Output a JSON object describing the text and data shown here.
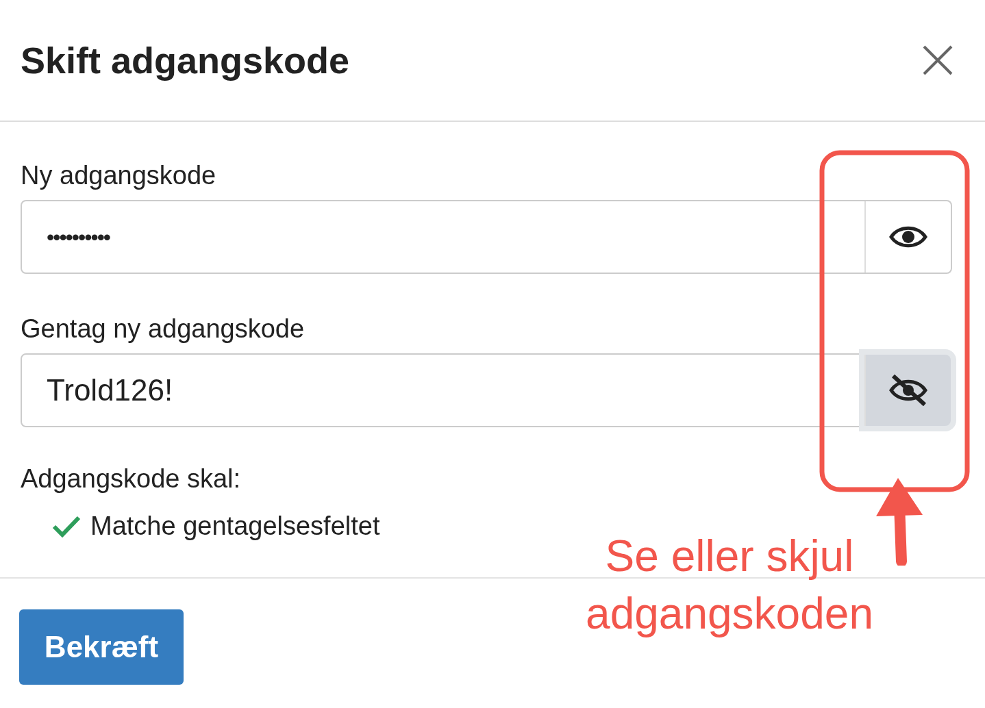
{
  "dialog": {
    "title": "Skift adgangskode"
  },
  "fields": [
    {
      "label": "Ny adgangskode",
      "value": "••••••••••",
      "masked": true,
      "toggle_pressed": false
    },
    {
      "label": "Gentag ny adgangskode",
      "value": "Trold126!",
      "masked": false,
      "toggle_pressed": true
    }
  ],
  "requirements": {
    "heading": "Adgangskode skal:",
    "items": [
      {
        "text": "Matche gentagelsesfeltet",
        "met": true
      }
    ]
  },
  "buttons": [
    "Bekræft"
  ],
  "annotation": {
    "lines": [
      "Se eller skjul",
      "adgangskoden"
    ]
  }
}
